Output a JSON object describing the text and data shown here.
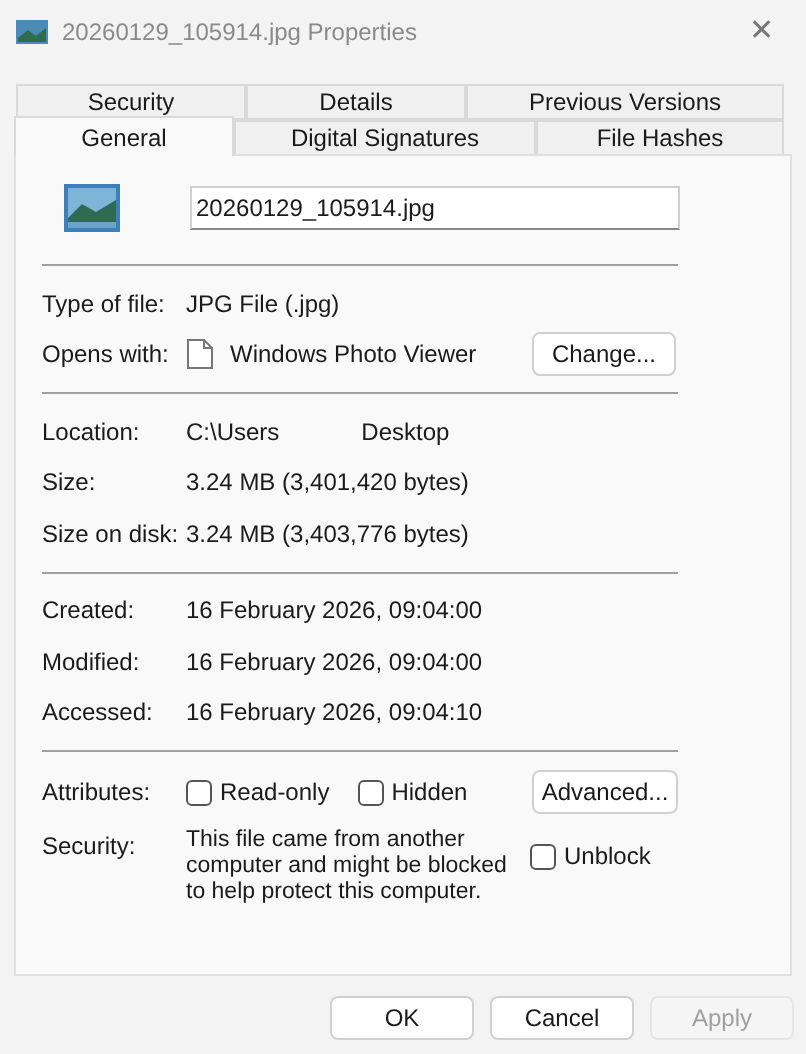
{
  "window": {
    "title": "20260129_105914.jpg Properties",
    "close": "✕"
  },
  "tabs_back": [
    {
      "label": "Security",
      "selected": false
    },
    {
      "label": "Details",
      "selected": false
    },
    {
      "label": "Previous Versions",
      "selected": false
    }
  ],
  "tabs_front": [
    {
      "label": "General",
      "selected": true
    },
    {
      "label": "Digital Signatures",
      "selected": false
    },
    {
      "label": "File Hashes",
      "selected": false
    }
  ],
  "file_name": "20260129_105914.jpg",
  "type": {
    "label": "Type of file:",
    "value": "JPG File (.jpg)"
  },
  "opens_with": {
    "label": "Opens with:",
    "value": "Windows Photo Viewer",
    "button": "Change..."
  },
  "location": {
    "label": "Location:",
    "value_start": "C:\\Users",
    "value_end": "Desktop"
  },
  "sizes": [
    {
      "label": "Size:",
      "value": "3.24 MB (3,401,420 bytes)"
    },
    {
      "label": "Size on disk:",
      "value": "3.24 MB (3,403,776 bytes)"
    }
  ],
  "dates": [
    {
      "label": "Created:",
      "value": "16 February 2026, 09:04:00"
    },
    {
      "label": "Modified:",
      "value": "16 February 2026, 09:04:00"
    },
    {
      "label": "Accessed:",
      "value": "16 February 2026, 09:04:10"
    }
  ],
  "attributes": {
    "label": "Attributes:",
    "checkboxes": [
      {
        "label": "Read-only",
        "checked": false
      },
      {
        "label": "Hidden",
        "checked": false
      }
    ],
    "button": "Advanced..."
  },
  "security": {
    "label": "Security:",
    "text": "This file came from another computer and might be blocked to help protect this computer.",
    "unblock": {
      "label": "Unblock",
      "checked": false
    }
  },
  "buttons": [
    {
      "label": "OK",
      "disabled": false
    },
    {
      "label": "Cancel",
      "disabled": false
    },
    {
      "label": "Apply",
      "disabled": true
    }
  ]
}
